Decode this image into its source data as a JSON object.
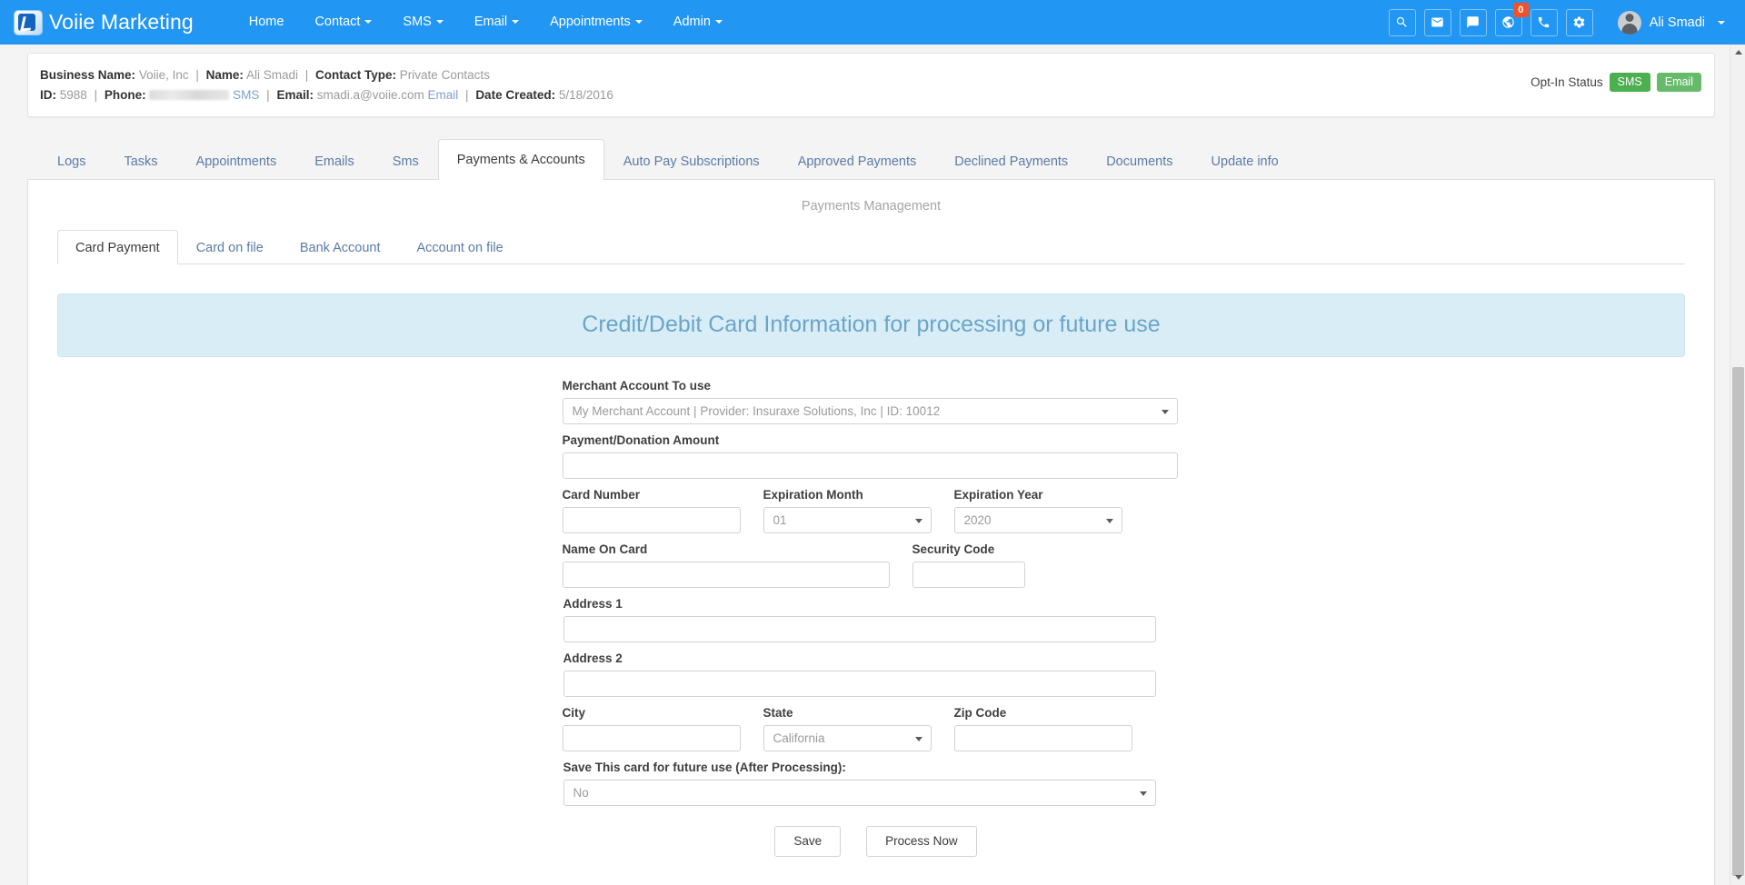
{
  "navbar": {
    "brand": "Voiie Marketing",
    "logo_icon": "voiie-logo-icon",
    "items": [
      {
        "label": "Home",
        "caret": false
      },
      {
        "label": "Contact",
        "caret": true
      },
      {
        "label": "SMS",
        "caret": true
      },
      {
        "label": "Email",
        "caret": true
      },
      {
        "label": "Appointments",
        "caret": true
      },
      {
        "label": "Admin",
        "caret": true
      }
    ],
    "icons": [
      {
        "name": "search-icon",
        "badge": null
      },
      {
        "name": "envelope-icon",
        "badge": null
      },
      {
        "name": "chat-bubble-icon",
        "badge": null
      },
      {
        "name": "globe-icon",
        "badge": "0"
      },
      {
        "name": "phone-icon",
        "badge": null
      },
      {
        "name": "gear-icon",
        "badge": null
      }
    ],
    "user": "Ali Smadi",
    "accent_color": "#2196f3",
    "badge_color": "#f0522a"
  },
  "contact_info": {
    "line1": {
      "business_name_label": "Business Name:",
      "business_name_value": "Voiie, Inc",
      "name_label": "Name:",
      "name_value": "Ali Smadi",
      "contact_type_label": "Contact Type:",
      "contact_type_value": "Private Contacts"
    },
    "line2": {
      "id_label": "ID:",
      "id_value": "5988",
      "phone_label": "Phone:",
      "phone_value": "",
      "sms_link": "SMS",
      "email_label": "Email:",
      "email_value": "smadi.a@voiie.com",
      "email_link": "Email",
      "date_created_label": "Date Created:",
      "date_created_value": "5/18/2016"
    },
    "optin": {
      "label": "Opt-In Status",
      "sms_badge": "SMS",
      "email_badge": "Email",
      "sms_color": "#4caf50",
      "email_color": "#66bb6a"
    }
  },
  "main_tabs": [
    {
      "label": "Logs",
      "active": false
    },
    {
      "label": "Tasks",
      "active": false
    },
    {
      "label": "Appointments",
      "active": false
    },
    {
      "label": "Emails",
      "active": false
    },
    {
      "label": "Sms",
      "active": false
    },
    {
      "label": "Payments & Accounts",
      "active": true
    },
    {
      "label": "Auto Pay Subscriptions",
      "active": false
    },
    {
      "label": "Approved Payments",
      "active": false
    },
    {
      "label": "Declined Payments",
      "active": false
    },
    {
      "label": "Documents",
      "active": false
    },
    {
      "label": "Update info",
      "active": false
    }
  ],
  "panel": {
    "subtitle": "Payments Management",
    "sub_tabs": [
      {
        "label": "Card Payment",
        "active": true
      },
      {
        "label": "Card on file",
        "active": false
      },
      {
        "label": "Bank Account",
        "active": false
      },
      {
        "label": "Account on file",
        "active": false
      }
    ],
    "banner": "Credit/Debit Card Information for processing or future use",
    "banner_bg": "#d9edf7",
    "banner_color": "#6aa5c9"
  },
  "form": {
    "merchant": {
      "label": "Merchant Account To use",
      "value": "My Merchant Account | Provider: Insuraxe Solutions, Inc | ID: 10012"
    },
    "amount": {
      "label": "Payment/Donation Amount",
      "value": "",
      "placeholder": ""
    },
    "card_number": {
      "label": "Card Number",
      "value": "",
      "placeholder": ""
    },
    "exp_month": {
      "label": "Expiration Month",
      "value": "01"
    },
    "exp_year": {
      "label": "Expiration Year",
      "value": "2020"
    },
    "name_on_card": {
      "label": "Name On Card",
      "value": "",
      "placeholder": ""
    },
    "security_code": {
      "label": "Security Code",
      "value": "",
      "placeholder": ""
    },
    "address1": {
      "label": "Address 1",
      "value": "",
      "placeholder": ""
    },
    "address2": {
      "label": "Address 2",
      "value": "",
      "placeholder": ""
    },
    "city": {
      "label": "City",
      "value": "",
      "placeholder": ""
    },
    "state": {
      "label": "State",
      "value": "California"
    },
    "zip": {
      "label": "Zip Code",
      "value": "",
      "placeholder": ""
    },
    "save_card": {
      "label": "Save This card for future use (After Processing):",
      "value": "No"
    },
    "buttons": {
      "save": "Save",
      "process": "Process Now"
    }
  }
}
